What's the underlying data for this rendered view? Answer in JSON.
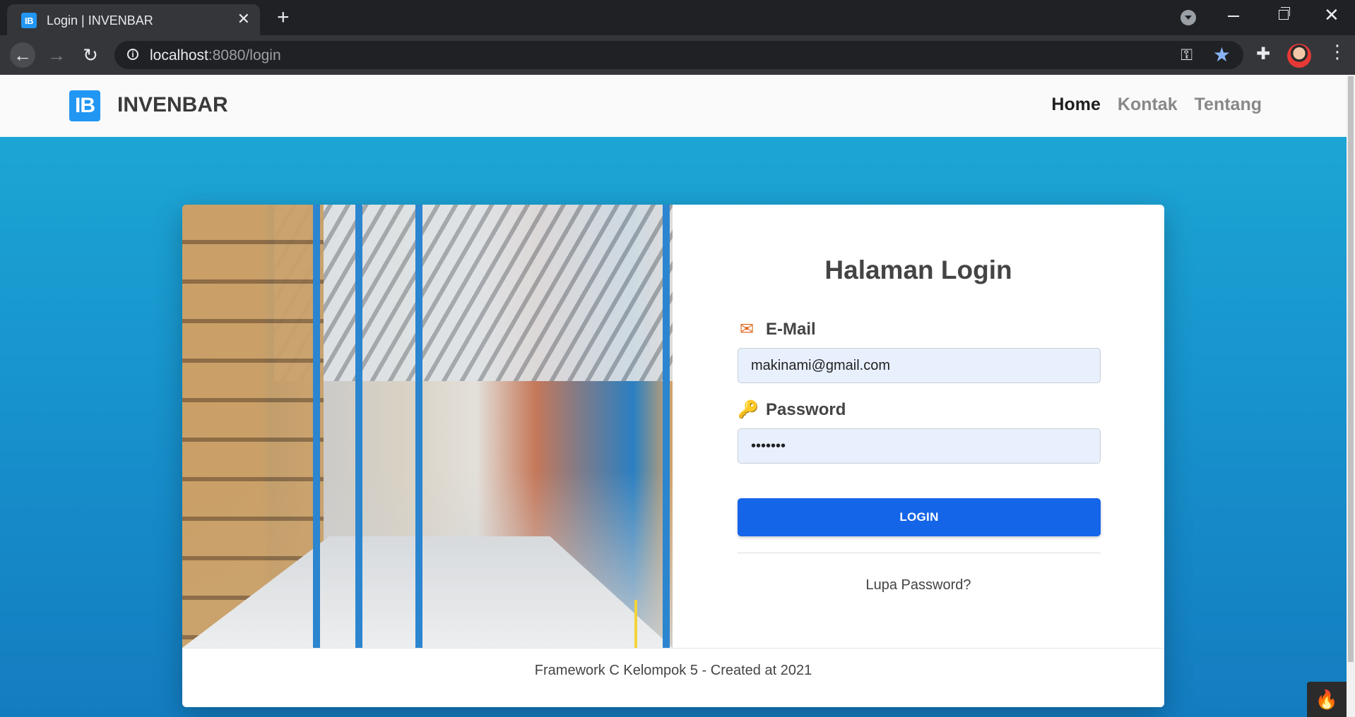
{
  "browser": {
    "tab_title": "Login | INVENBAR",
    "tab_favicon_text": "IB",
    "url_host": "localhost",
    "url_rest": ":8080/login",
    "icons": {
      "back": "arrow-left-icon",
      "forward": "arrow-right-icon",
      "reload": "reload-icon",
      "info": "info-icon",
      "key": "key-icon",
      "bookmark": "star-icon",
      "extensions": "puzzle-icon",
      "menu": "kebab-menu-icon"
    }
  },
  "navbar": {
    "logo_text": "IB",
    "brand": "INVENBAR",
    "links": [
      {
        "label": "Home",
        "active": true
      },
      {
        "label": "Kontak",
        "active": false
      },
      {
        "label": "Tentang",
        "active": false
      }
    ]
  },
  "login": {
    "title": "Halaman Login",
    "email_label": "E-Mail",
    "email_value": "makinami@gmail.com",
    "password_label": "Password",
    "password_value": "•••••••",
    "button_label": "LOGIN",
    "forgot_label": "Lupa Password?"
  },
  "footer": {
    "text": "Framework C Kelompok 5 - Created at 2021"
  },
  "colors": {
    "accent": "#1565e8",
    "brand_logo": "#2196f3",
    "label_icon": "#e06a1f",
    "background_top": "#1eaad6",
    "background_bottom": "#137cc0"
  }
}
